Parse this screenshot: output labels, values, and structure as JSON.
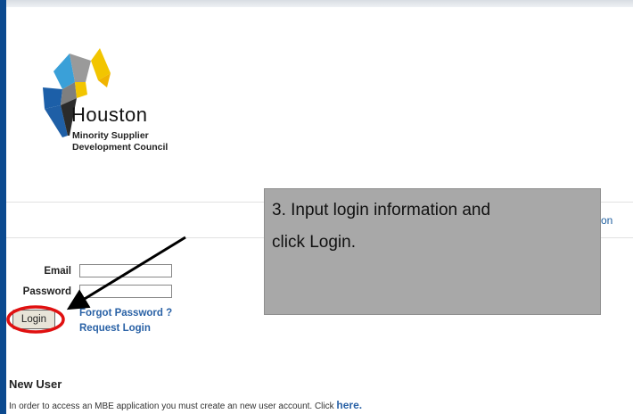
{
  "header": {
    "logo_word": "Houston",
    "logo_sub_line1": "Minority Supplier",
    "logo_sub_line2": "Development Council"
  },
  "nav": {
    "partial_link": "on"
  },
  "login": {
    "email_label": "Email",
    "password_label": "Password",
    "login_button": "Login",
    "forgot_password": "Forgot Password ?",
    "request_login": "Request Login"
  },
  "new_user": {
    "title": "New User",
    "text": "In order to access an MBE application you must create an new user account. Click ",
    "link": "here."
  },
  "annotation": {
    "callout_line1": "3. Input login information and",
    "callout_line2": "click Login.",
    "colors": {
      "callout_bg": "#a8a8a8",
      "highlight_ring": "#e01010",
      "arrow": "#000000"
    }
  },
  "colors": {
    "brand_blue": "#0b4a8f",
    "link_blue": "#2a62a6"
  }
}
